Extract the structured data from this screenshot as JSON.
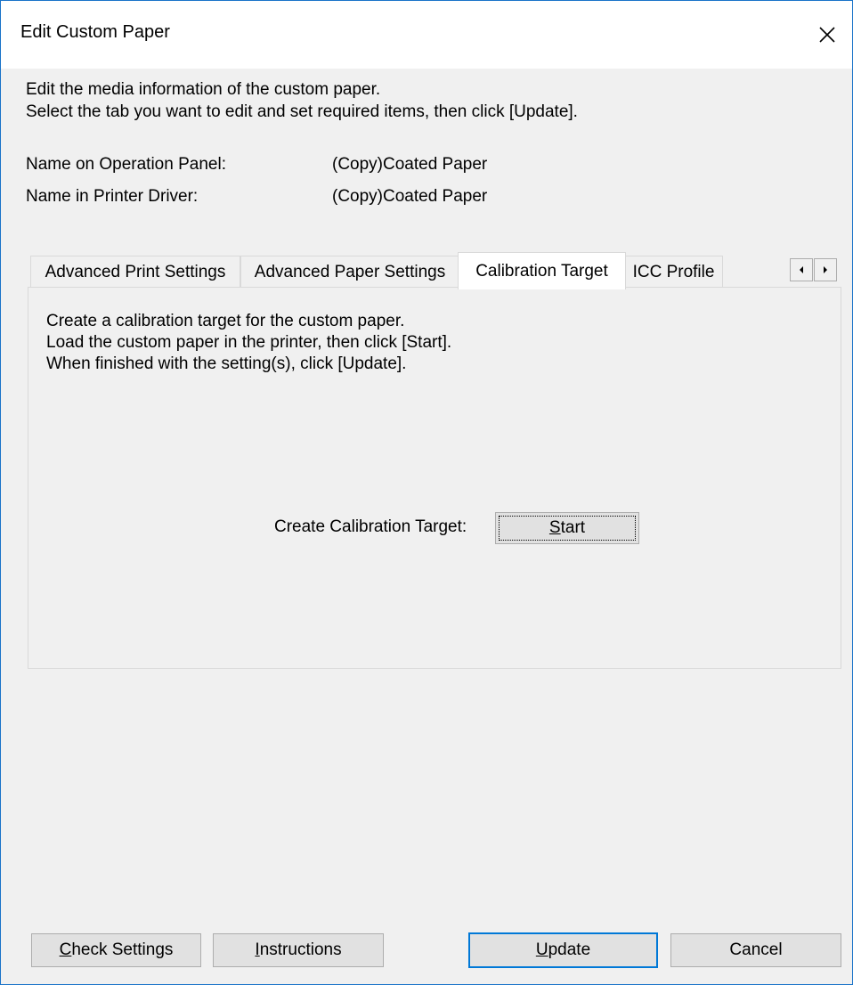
{
  "window": {
    "title": "Edit Custom Paper",
    "close_icon": "close-icon"
  },
  "description": {
    "line1": "Edit the media information of the custom paper.",
    "line2": "Select the tab you want to edit and set required items, then click [Update]."
  },
  "fields": {
    "operation_panel_label": "Name on Operation Panel:",
    "operation_panel_value": "(Copy)Coated Paper",
    "printer_driver_label": "Name in Printer Driver:",
    "printer_driver_value": "(Copy)Coated Paper"
  },
  "tabs": [
    {
      "label": "Advanced Print Settings"
    },
    {
      "label": "Advanced Paper Settings"
    },
    {
      "label": "Calibration Target",
      "active": true
    },
    {
      "label": "ICC Profile"
    }
  ],
  "tab_scroll": {
    "left_icon": "arrow-left-icon",
    "right_icon": "arrow-right-icon"
  },
  "panel": {
    "line1": "Create a calibration target for the custom paper.",
    "line2": "Load the custom paper in the printer, then click [Start].",
    "line3": "When finished with the setting(s), click [Update].",
    "calibration_label": "Create Calibration Target:",
    "start_button": {
      "first": "S",
      "rest": "tart"
    }
  },
  "buttons": {
    "check_settings": {
      "first": "C",
      "rest": "heck Settings"
    },
    "instructions": {
      "first": "I",
      "rest": "nstructions"
    },
    "update": {
      "first": "U",
      "rest": "pdate"
    },
    "cancel": "Cancel"
  },
  "colors": {
    "window_border": "#1a73c9",
    "focus_border": "#0078d7",
    "background": "#f0f0f0"
  }
}
